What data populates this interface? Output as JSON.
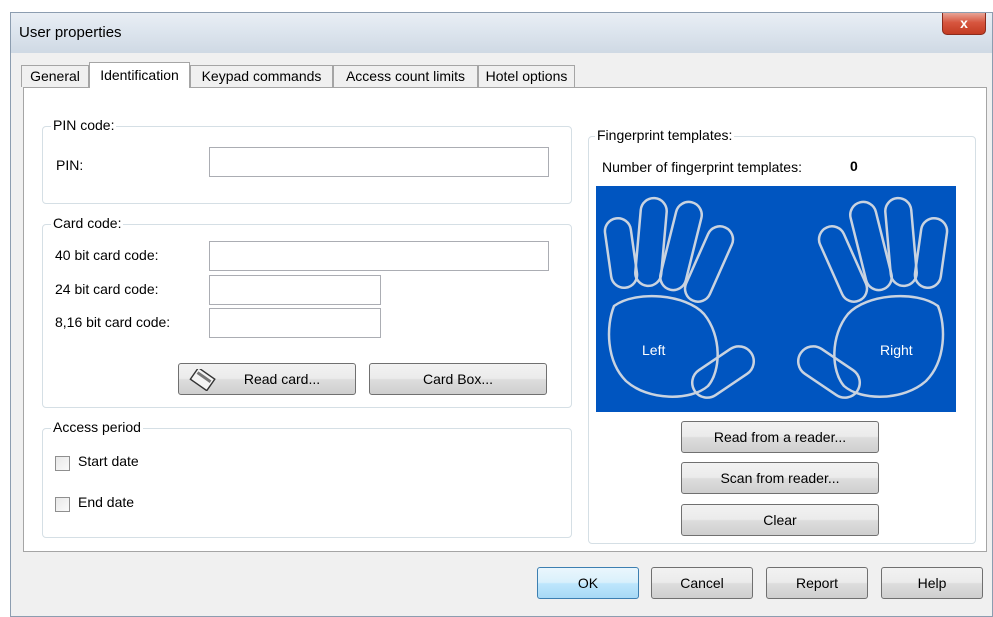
{
  "window": {
    "title": "User properties",
    "close_glyph": "x"
  },
  "tabs": [
    {
      "label": "General"
    },
    {
      "label": "Identification"
    },
    {
      "label": "Keypad commands"
    },
    {
      "label": "Access count limits"
    },
    {
      "label": "Hotel options"
    }
  ],
  "pin_group": {
    "legend": "PIN code:",
    "pin_label": "PIN:",
    "pin_value": ""
  },
  "card_group": {
    "legend": "Card code:",
    "bit40_label": "40 bit card code:",
    "bit24_label": "24 bit card code:",
    "bit816_label": "8,16 bit card code:",
    "read_card": "Read card...",
    "card_box": "Card Box..."
  },
  "access_group": {
    "legend": "Access period",
    "start_date": "Start date",
    "end_date": "End date"
  },
  "fingerprint": {
    "legend": "Fingerprint templates:",
    "count_label": "Number of fingerprint templates:",
    "count_value": "0",
    "left_label": "Left",
    "right_label": "Right",
    "bg_color": "#0055c0",
    "read_button": "Read from a reader...",
    "scan_button": "Scan from reader...",
    "clear_button": "Clear"
  },
  "footer": {
    "ok": "OK",
    "cancel": "Cancel",
    "report": "Report",
    "help": "Help"
  }
}
